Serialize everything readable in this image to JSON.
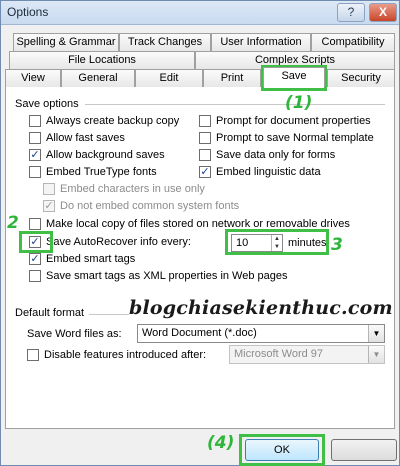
{
  "window": {
    "title": "Options",
    "help_label": "?",
    "close_label": "X"
  },
  "tabs": {
    "row1": [
      "Spelling & Grammar",
      "Track Changes",
      "User Information",
      "Compatibility"
    ],
    "row2": [
      "File Locations",
      "Complex Scripts"
    ],
    "row3": [
      "View",
      "General",
      "Edit",
      "Print",
      "Save",
      "Security"
    ],
    "active": "Save"
  },
  "save_options": {
    "heading": "Save options",
    "left": [
      {
        "label": "Always create backup copy",
        "checked": false
      },
      {
        "label": "Allow fast saves",
        "checked": false
      },
      {
        "label": "Allow background saves",
        "checked": true
      },
      {
        "label": "Embed TrueType fonts",
        "checked": false
      },
      {
        "label": "Embed characters in use only",
        "checked": false,
        "disabled": true
      },
      {
        "label": "Do not embed common system fonts",
        "checked": true,
        "disabled": true
      }
    ],
    "right": [
      {
        "label": "Prompt for document properties",
        "checked": false
      },
      {
        "label": "Prompt to save Normal template",
        "checked": false
      },
      {
        "label": "Save data only for forms",
        "checked": false
      },
      {
        "label": "Embed linguistic data",
        "checked": true
      }
    ],
    "make_local_copy": {
      "label": "Make local copy of files stored on network or removable drives",
      "checked": false
    },
    "autorecover": {
      "label": "Save AutoRecover info every:",
      "checked": true,
      "value": "10",
      "unit": "minutes"
    },
    "embed_smart_tags": {
      "label": "Embed smart tags",
      "checked": true
    },
    "smart_tags_xml": {
      "label": "Save smart tags as XML properties in Web pages",
      "checked": false
    }
  },
  "default_format": {
    "heading": "Default format",
    "save_as_label": "Save Word files as:",
    "save_as_value": "Word Document (*.doc)",
    "disable_features": {
      "label": "Disable features introduced after:",
      "checked": false
    },
    "disable_value": "Microsoft Word 97"
  },
  "watermark": "blogchiasekienthuc.com",
  "annotations": {
    "n1": "(1)",
    "n2": "2",
    "n3": "3",
    "n4": "(4)"
  },
  "buttons": {
    "ok": "OK"
  },
  "colors": {
    "annotation": "#3fbf45",
    "accent": "#3c7fb1"
  }
}
